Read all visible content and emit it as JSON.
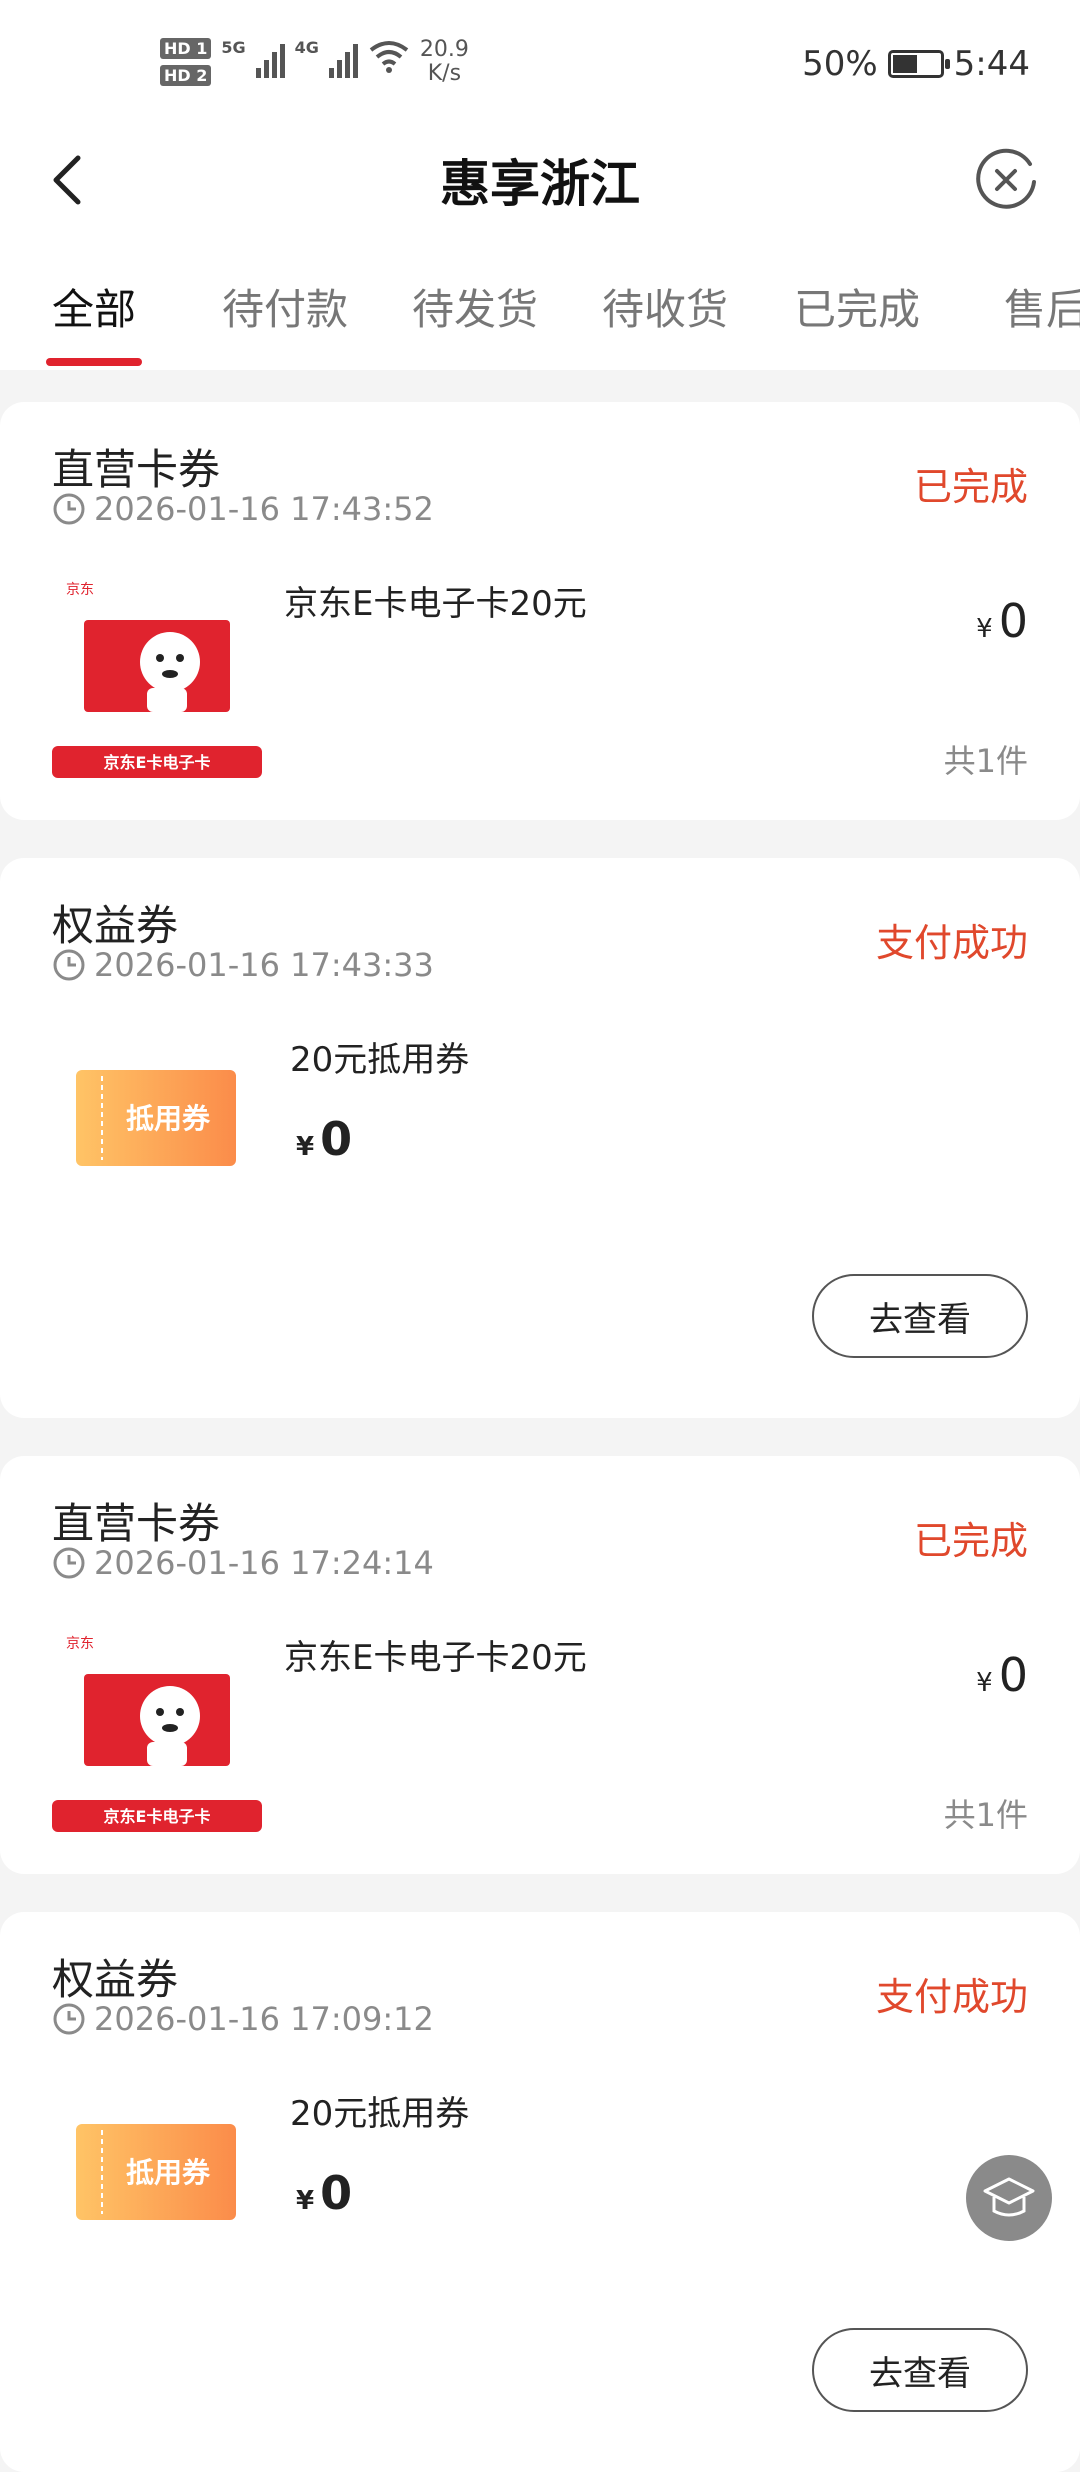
{
  "status_bar": {
    "hd1": "HD 1",
    "hd2": "HD 2",
    "net1": "5G",
    "net2": "4G",
    "speed_value": "20.9",
    "speed_unit": "K/s",
    "battery": "50%",
    "time": "5:44"
  },
  "nav": {
    "title": "惠享浙江",
    "back_icon": "chevron-left-icon",
    "close_icon": "close-circle-icon"
  },
  "tabs": [
    "全部",
    "待付款",
    "待发货",
    "待收货",
    "已完成",
    "售后"
  ],
  "active_tab": 0,
  "orders": [
    {
      "type": "direct",
      "title": "直营卡券",
      "time": "2026-01-16 17:43:52",
      "status": "已完成",
      "product": "京东E卡电子卡20元",
      "currency": "¥",
      "price": "0",
      "qty": "共1件",
      "img_brand": "京东",
      "img_caption": "京东E卡电子卡"
    },
    {
      "type": "coupon",
      "title": "权益券",
      "time": "2026-01-16 17:43:33",
      "status": "支付成功",
      "product": "20元抵用券",
      "currency": "¥",
      "price": "0",
      "button": "去查看",
      "img_text": "抵用券"
    },
    {
      "type": "direct",
      "title": "直营卡券",
      "time": "2026-01-16 17:24:14",
      "status": "已完成",
      "product": "京东E卡电子卡20元",
      "currency": "¥",
      "price": "0",
      "qty": "共1件",
      "img_brand": "京东",
      "img_caption": "京东E卡电子卡"
    },
    {
      "type": "coupon",
      "title": "权益券",
      "time": "2026-01-16 17:09:12",
      "status": "支付成功",
      "product": "20元抵用券",
      "currency": "¥",
      "price": "0",
      "button": "去查看",
      "img_text": "抵用券"
    }
  ],
  "colors": {
    "accent_red": "#e0232e",
    "status_red": "#e0482c",
    "coupon_orange": "#fb8c4a"
  },
  "float_button_icon": "graduation-cap-icon"
}
